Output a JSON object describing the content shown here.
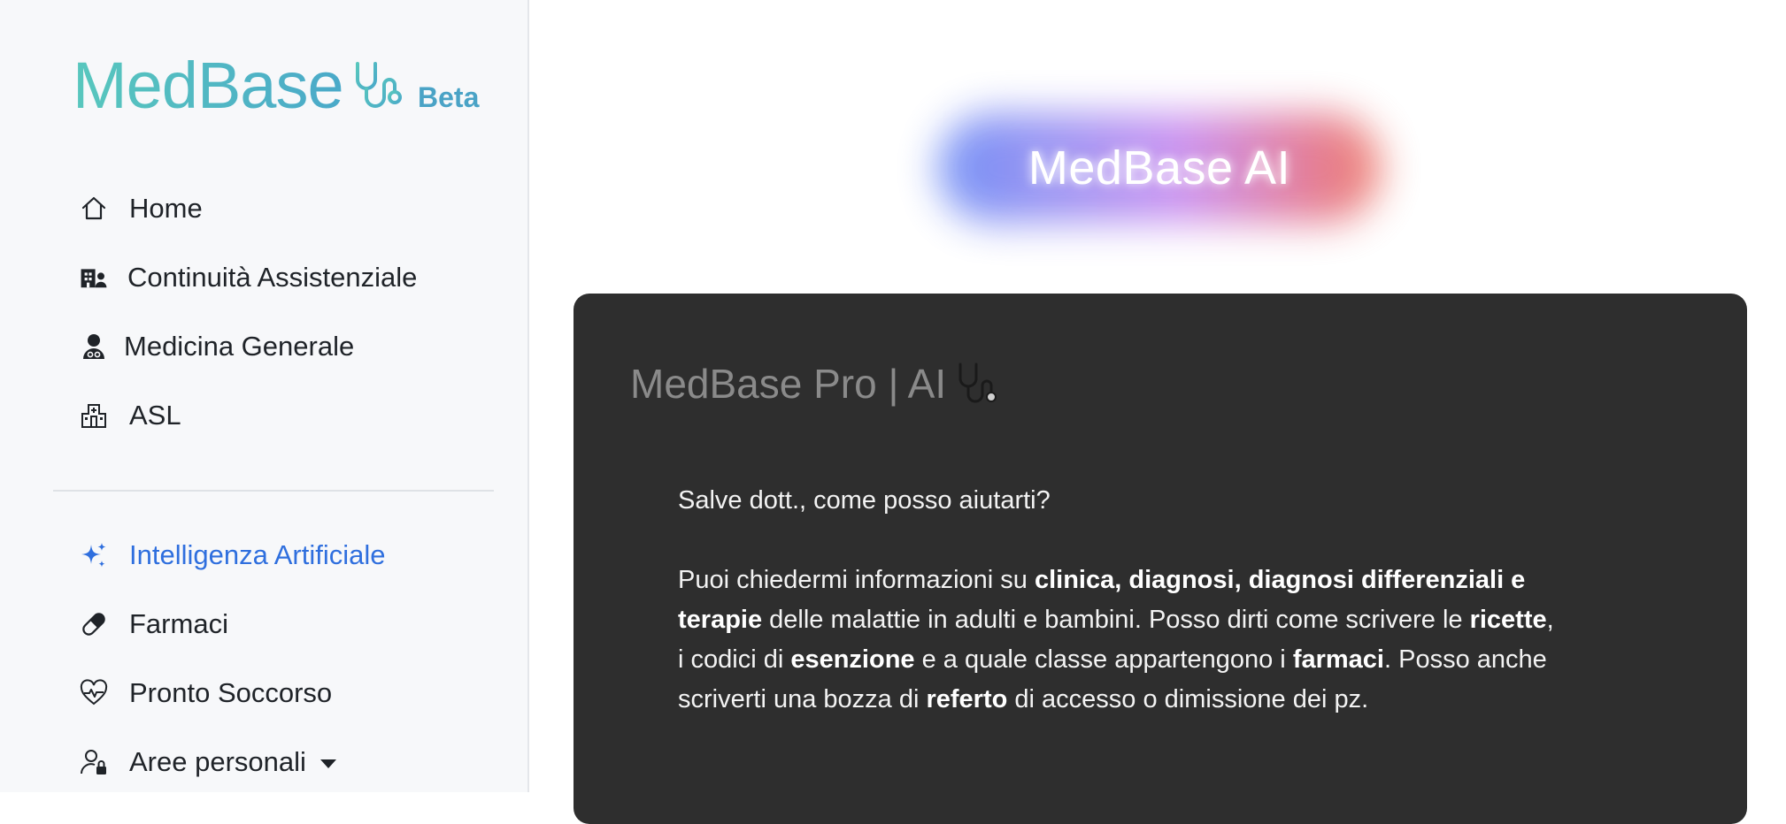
{
  "brand": {
    "name": "MedBase",
    "badge": "Beta",
    "colors": {
      "gradient_start": "#58c7bd",
      "gradient_end": "#4aa9c9",
      "badge": "#4aa3c6"
    }
  },
  "sidebar": {
    "primary": [
      {
        "label": "Home",
        "icon": "home-icon"
      },
      {
        "label": "Continuità Assistenziale",
        "icon": "hospital-user-icon"
      },
      {
        "label": "Medicina Generale",
        "icon": "doctor-icon"
      },
      {
        "label": "ASL",
        "icon": "hospital-icon"
      }
    ],
    "secondary": [
      {
        "label": "Intelligenza Artificiale",
        "icon": "sparkles-icon",
        "active": true
      },
      {
        "label": "Farmaci",
        "icon": "pill-icon"
      },
      {
        "label": "Pronto Soccorso",
        "icon": "heart-pulse-icon"
      },
      {
        "label": "Aree personali",
        "icon": "person-lock-icon",
        "dropdown": true
      }
    ],
    "active_color": "#2f6fde"
  },
  "hero": {
    "title": "MedBase AI"
  },
  "chat": {
    "title": "MedBase Pro | AI",
    "title_icon": "stethoscope-icon",
    "greeting": "Salve dott., come posso aiutarti?",
    "intro": {
      "t1": "Puoi chiedermi informazioni su ",
      "b1": "clinica, diagnosi, diagnosi differenziali e terapie",
      "t2": " delle malattie in adulti e bambini. Posso dirti come scrivere le ",
      "b2": "ricette",
      "t3": ", i codici di ",
      "b3": "esenzione",
      "t4": " e a quale classe appartengono i ",
      "b4": "farmaci",
      "t5": ". Posso anche scriverti una bozza di ",
      "b5": "referto",
      "t6": " di accesso o dimissione dei pz."
    }
  }
}
